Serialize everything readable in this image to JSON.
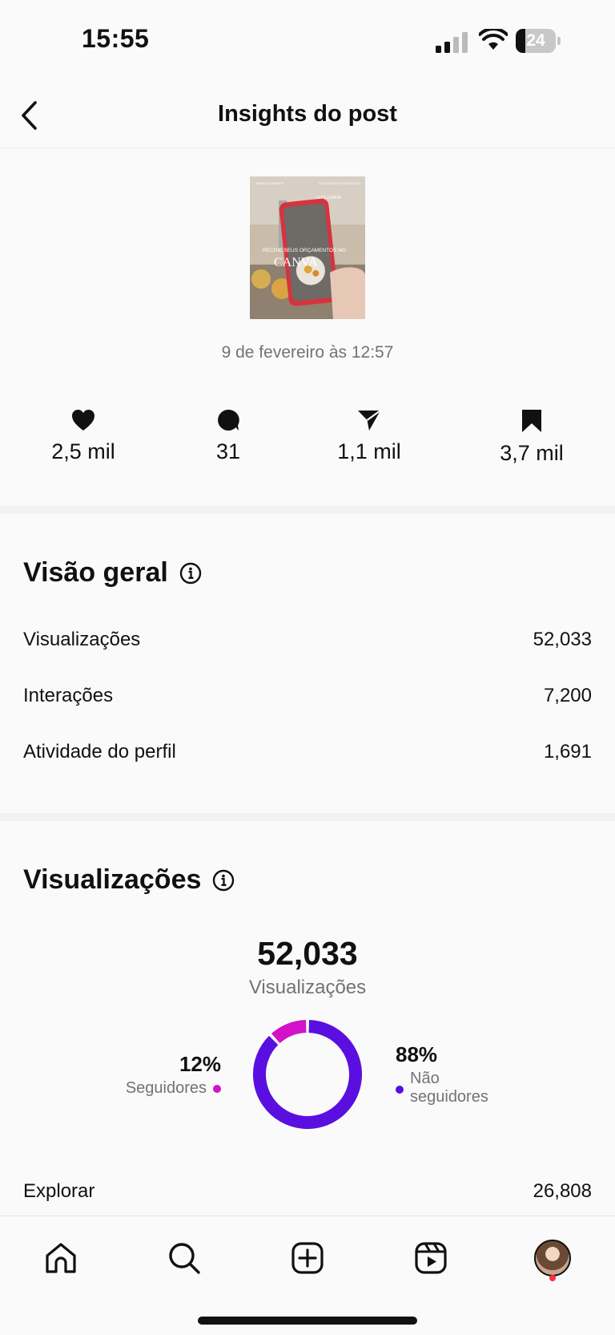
{
  "status_bar": {
    "time": "15:55",
    "battery": "24",
    "battery_level": 0.24
  },
  "header": {
    "title": "Insights do post"
  },
  "post": {
    "date": "9 de fevereiro às 12:57",
    "thumbnail_text": {
      "top_left": "ANNICIA CAMPOS",
      "top_right": "CONTEÚDO ESTRATÉGICO",
      "tag": "LET'S CANVA",
      "headline": "RECRIE SEUS ORÇAMENTOS NO",
      "brand": "CANVA"
    }
  },
  "stats": [
    {
      "icon": "heart-icon",
      "value": "2,5 mil"
    },
    {
      "icon": "comment-icon",
      "value": "31"
    },
    {
      "icon": "share-icon",
      "value": "1,1 mil"
    },
    {
      "icon": "bookmark-icon",
      "value": "3,7 mil"
    }
  ],
  "overview": {
    "title": "Visão geral",
    "rows": [
      {
        "label": "Visualizações",
        "value": "52,033"
      },
      {
        "label": "Interações",
        "value": "7,200"
      },
      {
        "label": "Atividade do perfil",
        "value": "1,691"
      }
    ]
  },
  "views": {
    "title": "Visualizações",
    "total": "52,033",
    "total_label": "Visualizações",
    "followers_pct": "12%",
    "followers_label": "Seguidores",
    "nonfollowers_pct": "88%",
    "nonfollowers_label_1": "Não",
    "nonfollowers_label_2": "seguidores",
    "followers_fraction": 0.12,
    "colors": {
      "followers": "#d311c9",
      "nonfollowers": "#5a0fe0"
    },
    "sources": [
      {
        "label": "Explorar",
        "value": "26,808"
      }
    ]
  },
  "tab_bar": {
    "tabs": [
      "home-icon",
      "search-icon",
      "create-icon",
      "reels-icon",
      "profile-avatar"
    ]
  }
}
